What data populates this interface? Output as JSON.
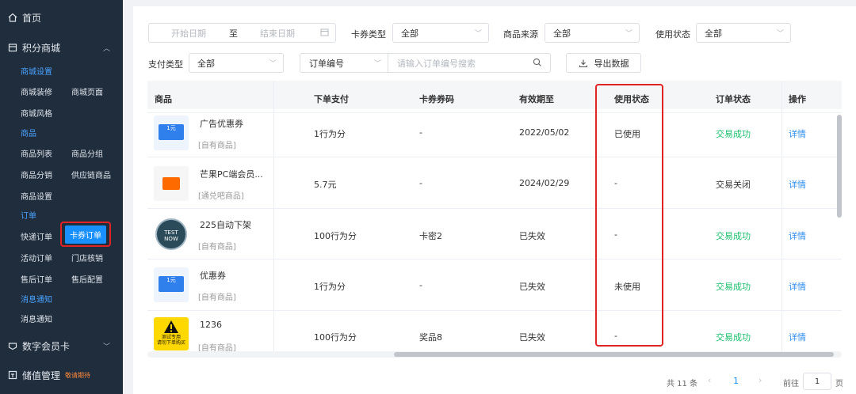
{
  "sidebar": {
    "home": "首页",
    "points_mall": "积分商城",
    "mall_settings_section": "商城设置",
    "mall_decor": "商城装修",
    "mall_pages": "商城页面",
    "mall_style": "商城风格",
    "goods_section": "商品",
    "goods_list": "商品列表",
    "goods_group": "商品分组",
    "goods_dist": "商品分销",
    "supply_goods": "供应链商品",
    "goods_settings": "商品设置",
    "orders_section": "订单",
    "express_orders": "快递订单",
    "coupon_orders": "卡券订单",
    "activity_orders": "活动订单",
    "store_verify": "门店核销",
    "aftersale_orders": "售后订单",
    "aftersale_config": "售后配置",
    "notify_section": "消息通知",
    "notify": "消息通知",
    "digital_card": "数字会员卡",
    "stored_value": "储值管理",
    "stay_tuned": "敬请期待"
  },
  "filters": {
    "start_date_ph": "开始日期",
    "to": "至",
    "end_date_ph": "结束日期",
    "card_type_label": "卡券类型",
    "card_type_value": "全部",
    "source_label": "商品来源",
    "source_value": "全部",
    "use_status_label": "使用状态",
    "use_status_value": "全部",
    "pay_type_label": "支付类型",
    "pay_type_value": "全部",
    "order_no_select": "订单编号",
    "order_no_ph": "请输入订单编号搜索",
    "export": "导出数据"
  },
  "table": {
    "headers": [
      "商品",
      "下单支付",
      "卡券券码",
      "有效期至",
      "使用状态",
      "订单状态",
      "操作"
    ],
    "rows": [
      {
        "name": "广告优惠券",
        "source": "[自有商品]",
        "pay": "1行为分",
        "code": "-",
        "valid": "2022/05/02",
        "use": "已使用",
        "status": "交易成功",
        "op": "详情"
      },
      {
        "name": "芒果PC端会员...",
        "source": "[通兑吧商品]",
        "pay": "5.7元",
        "code": "-",
        "valid": "2024/02/29",
        "use": "-",
        "status": "交易关闭",
        "op": "详情"
      },
      {
        "name": "225自动下架",
        "source": "[自有商品]",
        "pay": "100行为分",
        "code": "卡密2",
        "valid": "已失效",
        "use": "-",
        "status": "交易成功",
        "op": "详情"
      },
      {
        "name": "优惠券",
        "source": "[自有商品]",
        "pay": "1行为分",
        "code": "-",
        "valid": "已失效",
        "use": "未使用",
        "status": "交易成功",
        "op": "详情"
      },
      {
        "name": "1236",
        "source": "[自有商品]",
        "pay": "100行为分",
        "code": "奖品8",
        "valid": "已失效",
        "use": "-",
        "status": "交易成功",
        "op": "详情"
      }
    ],
    "thumb_texts": {
      "coupon_1": "1",
      "coupon_unit": "元",
      "test_now_1": "TEST",
      "test_now_2": "NOW",
      "warn_1": "测试专用",
      "warn_2": "请勿下单购买"
    }
  },
  "pagination": {
    "total": "共 11 条",
    "current": "1",
    "goto": "前往",
    "page_value": "1",
    "page_unit": "页"
  },
  "colors": {
    "sidebar_bg": "#1f2d3d",
    "accent": "#1890ff",
    "success": "#19be6b",
    "highlight_box": "#e02424"
  }
}
